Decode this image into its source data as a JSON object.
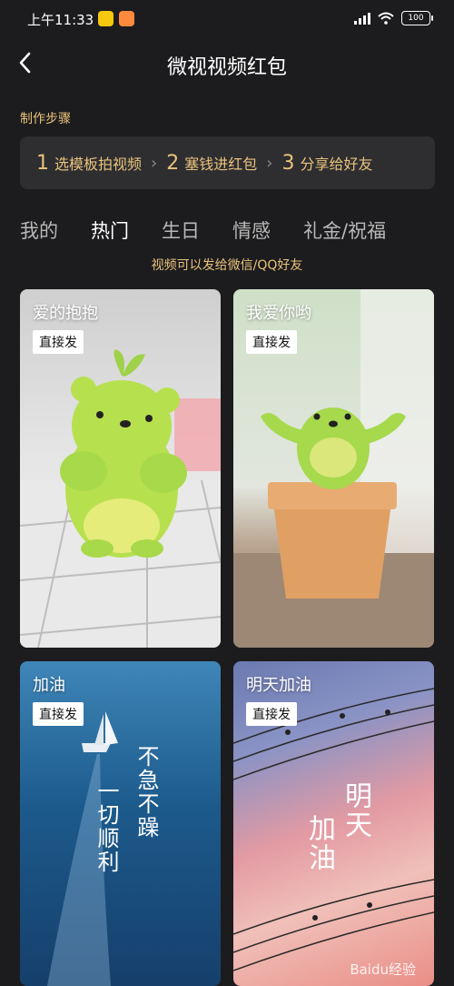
{
  "status": {
    "time": "上午11:33",
    "battery": "100"
  },
  "header": {
    "title": "微视视频红包"
  },
  "steps": {
    "label": "制作步骤",
    "items": [
      {
        "num": "1",
        "text": "选模板拍视频"
      },
      {
        "num": "2",
        "text": "塞钱进红包"
      },
      {
        "num": "3",
        "text": "分享给好友"
      }
    ],
    "separator": "›"
  },
  "tabs": [
    "我的",
    "热门",
    "生日",
    "情感",
    "礼金/祝福"
  ],
  "active_tab": "热门",
  "hint": "视频可以发给微信/QQ好友",
  "cards": [
    {
      "title": "爱的抱抱",
      "button": "直接发"
    },
    {
      "title": "我爱你哟",
      "button": "直接发"
    },
    {
      "title": "加油",
      "button": "直接发",
      "calligraphy": [
        "不急不躁",
        "一切顺利"
      ]
    },
    {
      "title": "明天加油",
      "button": "直接发",
      "calligraphy": [
        "明天",
        "加油"
      ]
    }
  ],
  "watermark": "Baidu经验"
}
